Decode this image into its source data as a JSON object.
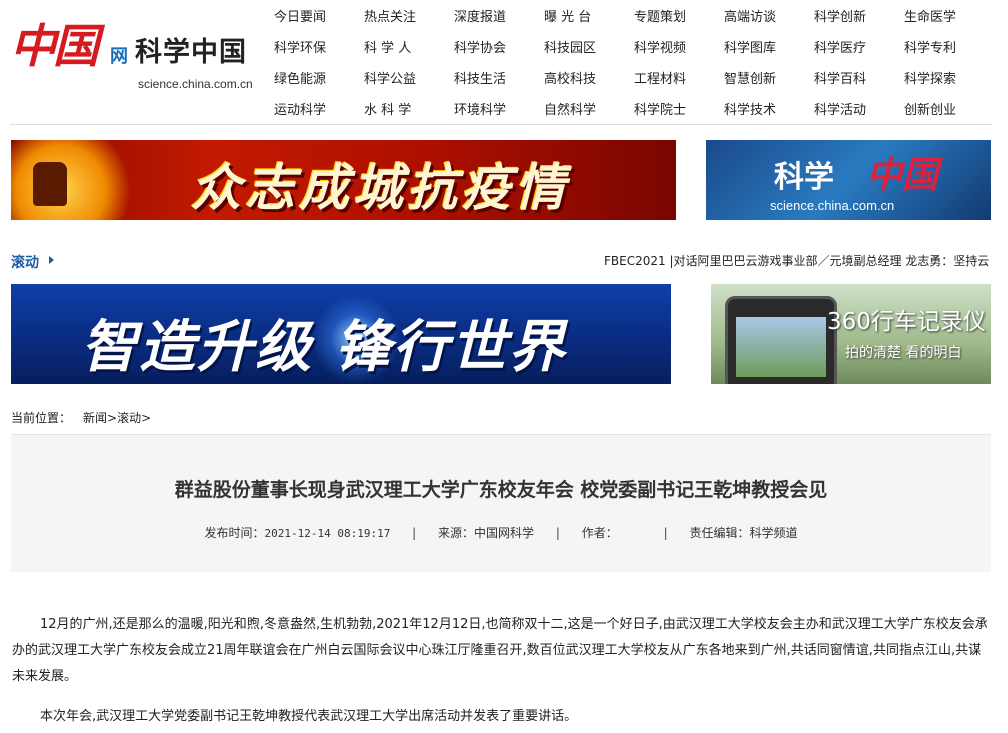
{
  "logo": {
    "zh": "中国",
    "wang": "网",
    "title": "科学中国",
    "url": "science.china.com.cn"
  },
  "nav": [
    [
      "今日要闻",
      "热点关注",
      "深度报道",
      "曝 光 台",
      "专题策划",
      "高端访谈",
      "科学创新",
      "生命医学"
    ],
    [
      "科学环保",
      "科 学 人",
      "科学协会",
      "科技园区",
      "科学视频",
      "科学图库",
      "科学医疗",
      "科学专利"
    ],
    [
      "绿色能源",
      "科学公益",
      "科技生活",
      "高校科技",
      "工程材料",
      "智慧创新",
      "科学百科",
      "科学探索"
    ],
    [
      "运动科学",
      "水 科 学",
      "环境科学",
      "自然科学",
      "科学院士",
      "科学技术",
      "科学活动",
      "创新创业"
    ]
  ],
  "banners": {
    "b1_text": "众志成城抗疫情",
    "b2_title": "科学",
    "b2_logo": "中国",
    "b2_url": "science.china.com.cn",
    "b3_text": "智造升级 锋行世界",
    "b4_title": "360行车记录仪",
    "b4_sub": "拍的清楚 看的明白"
  },
  "scroll": {
    "label": "滚动",
    "text": "FBEC2021 |对话阿里巴巴云游戏事业部／元境副总经理 龙志勇：坚持云"
  },
  "breadcrumb": {
    "prefix": "当前位置：",
    "path": "新闻>滚动>"
  },
  "article": {
    "title": "群益股份董事长现身武汉理工大学广东校友年会  校党委副书记王乾坤教授会见",
    "meta": {
      "time_label": "发布时间：",
      "time": "2021-12-14 08:19:17",
      "source_label": "来源：",
      "source": "中国网科学",
      "author_label": "作者：",
      "author": "",
      "editor_label": "责任编辑：",
      "editor": "科学频道",
      "sep": "|"
    },
    "paragraphs": [
      "12月的广州,还是那么的温暖,阳光和煦,冬意盎然,生机勃勃,2021年12月12日,也简称双十二,这是一个好日子,由武汉理工大学校友会主办和武汉理工大学广东校友会承办的武汉理工大学广东校友会成立21周年联谊会在广州白云国际会议中心珠江厅隆重召开,数百位武汉理工大学校友从广东各地来到广州,共话同窗情谊,共同指点江山,共谋未来发展。",
      "本次年会,武汉理工大学党委副书记王乾坤教授代表武汉理工大学出席活动并发表了重要讲话。"
    ]
  },
  "colors": {
    "brand_red": "#d71920",
    "link_blue": "#1a5ca8"
  }
}
